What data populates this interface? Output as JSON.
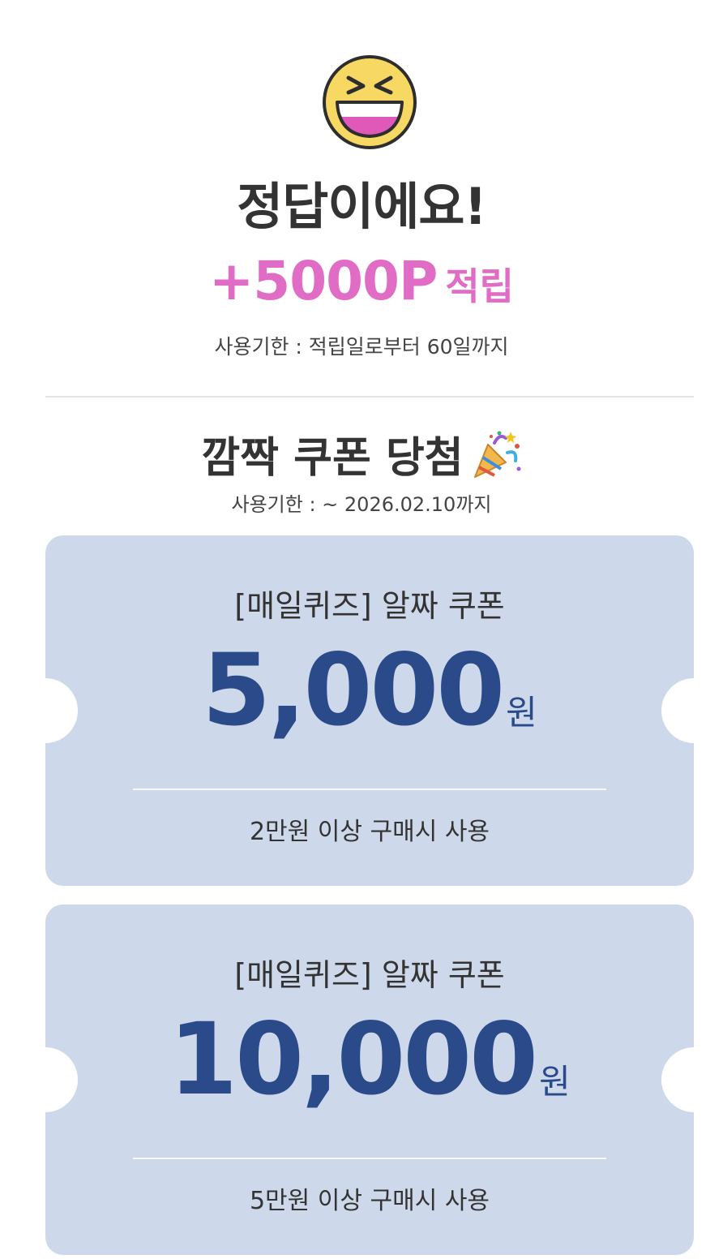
{
  "result": {
    "title": "정답이에요!",
    "points_amount": "+5000P",
    "points_suffix": "적립",
    "points_expiry": "사용기한 : 적립일로부터 60일까지"
  },
  "coupon_section": {
    "heading": "깜짝 쿠폰 당첨",
    "expiry": "사용기한 : ~ 2026.02.10까지",
    "coupons": [
      {
        "name": "[매일퀴즈] 알짜 쿠폰",
        "amount": "5,000",
        "unit": "원",
        "condition": "2만원 이상 구매시 사용"
      },
      {
        "name": "[매일퀴즈] 알짜 쿠폰",
        "amount": "10,000",
        "unit": "원",
        "condition": "5만원 이상 구매시 사용"
      }
    ]
  },
  "icons": {
    "result_emoji": "laughing-face-icon",
    "heading_emoji": "party-popper-icon"
  },
  "colors": {
    "points": "#e06cc6",
    "coupon_bg": "#cdd8ea",
    "coupon_amount": "#2b4a8a"
  }
}
